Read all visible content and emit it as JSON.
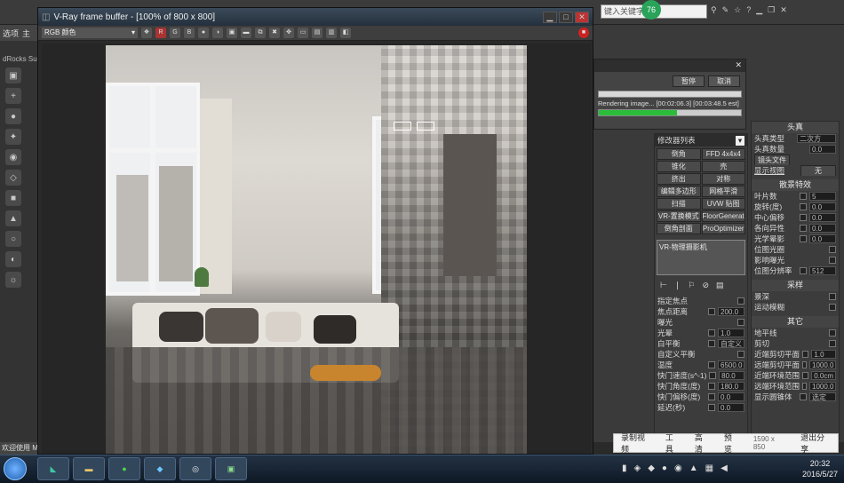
{
  "max": {
    "menu": [
      "选项",
      "主"
    ],
    "left_label": "dRocks Sub",
    "status_text": "欢迎使用 M"
  },
  "top": {
    "search_placeholder": "键入关键字",
    "badge": "76"
  },
  "vray": {
    "title": "V-Ray frame buffer - [100% of 800 x 800]",
    "channel": "RGB 颜色",
    "tools": [
      "R",
      "G",
      "B"
    ]
  },
  "progress": {
    "pause": "暂停",
    "cancel": "取消",
    "status": "Rendering image... [00:02:06.3] [00:03:48.5 est]",
    "fraction": 0.55
  },
  "modifier": {
    "list_label": "修改器列表",
    "buttons": [
      "倒角",
      "FFD 4x4x4",
      "锥化",
      "壳",
      "挤出",
      "对称",
      "编辑多边形",
      "网格平滑",
      "扫描",
      "UVW 贴图",
      "VR-置换模式",
      "FloorGenerator",
      "倒角剖面",
      "ProOptimizer"
    ],
    "stack_item": "VR-物理摄影机"
  },
  "camera_params": {
    "title": "头真",
    "type_label": "头真类型",
    "type_value": "二次方",
    "amount_label": "头真数量",
    "amount_value": "0.0",
    "file_label": "镜头文件",
    "fov_label": "显示视图",
    "fov_value": "无"
  },
  "bokeh": {
    "title": "散景特效",
    "rows": [
      {
        "label": "叶片数",
        "value": "5"
      },
      {
        "label": "旋转(度)",
        "value": "0.0"
      },
      {
        "label": "中心偏移",
        "value": "0.0"
      },
      {
        "label": "各向异性",
        "value": "0.0"
      },
      {
        "label": "光学晕影",
        "value": "0.0"
      },
      {
        "label": "位图光圈",
        "value": ""
      },
      {
        "label": "影响曝光",
        "value": ""
      },
      {
        "label": "位图分辨率",
        "value": "512"
      }
    ]
  },
  "sampling": {
    "title": "采样",
    "rows": [
      "景深",
      "运动模糊"
    ]
  },
  "other": {
    "title": "其它",
    "rows": [
      {
        "label": "地平线",
        "value": ""
      },
      {
        "label": "剪切",
        "value": ""
      },
      {
        "label": "近端剪切平面",
        "value": "1.0"
      },
      {
        "label": "远端剪切平面",
        "value": "1000.0"
      },
      {
        "label": "近端环境范围",
        "value": "0.0cm"
      },
      {
        "label": "远端环境范围",
        "value": "1000.0"
      },
      {
        "label": "显示圆锥体",
        "value": "选定"
      }
    ]
  },
  "basic": {
    "rows": [
      {
        "label": "指定焦点",
        "value": ""
      },
      {
        "label": "焦点距离",
        "value": "200.0"
      },
      {
        "label": "曝光",
        "value": ""
      },
      {
        "label": "光晕",
        "value": "1.0"
      },
      {
        "label": "白平衡",
        "value": "自定义"
      },
      {
        "label": "自定义平衡",
        "value": ""
      },
      {
        "label": "温度",
        "value": "6500.0"
      },
      {
        "label": "快门速度(s^-1)",
        "value": "80.0"
      },
      {
        "label": "快门角度(度)",
        "value": "180.0"
      },
      {
        "label": "快门偏移(度)",
        "value": "0.0"
      },
      {
        "label": "延迟(秒)",
        "value": "0.0"
      }
    ]
  },
  "record_bar": {
    "items": [
      "录制视频",
      "工具",
      "高清",
      "预览",
      "1590 x 850",
      "退出分享"
    ]
  },
  "taskbar": {
    "time": "20:32",
    "date": "2016/5/27"
  },
  "colors": {
    "progress_green": "#2bbd3a",
    "vray_red": "#cc2222",
    "taskbar": "#1a2a3a"
  }
}
